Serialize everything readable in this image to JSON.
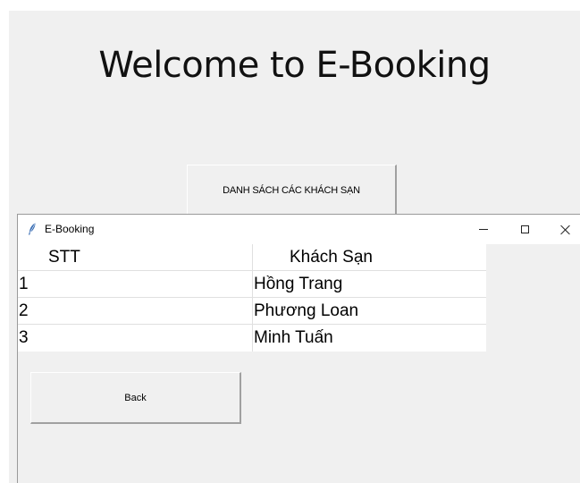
{
  "main_window": {
    "welcome_text": "Welcome to E-Booking",
    "hotel_list_button": "DANH SÁCH CÁC KHÁCH SẠN"
  },
  "popup": {
    "title": "E-Booking",
    "table": {
      "headers": [
        "STT",
        "Khách Sạn"
      ],
      "rows": [
        [
          "1",
          "Hồng Trang"
        ],
        [
          "2",
          "Phương Loan"
        ],
        [
          "3",
          "Minh Tuấn"
        ]
      ]
    },
    "back_button": "Back"
  },
  "icons": {
    "app_icon": "feather-icon",
    "minimize": "minimize-icon",
    "maximize": "maximize-icon",
    "close": "close-icon"
  },
  "colors": {
    "window_bg": "#f0f0f0",
    "titlebar_bg": "#ffffff",
    "table_bg": "#ffffff",
    "feather": "#3b6fb5"
  }
}
